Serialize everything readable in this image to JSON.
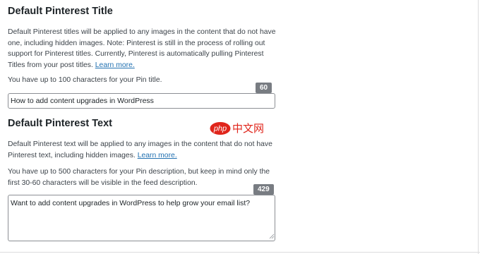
{
  "title_section": {
    "heading": "Default Pinterest Title",
    "description": "Default Pinterest titles will be applied to any images in the content that do not have one, including hidden images. Note: Pinterest is still in the process of rolling out support for Pinterest titles. Currently, Pinterest is automatically pulling Pinterest Titles from your post titles.",
    "learn_more": "Learn more.",
    "limit_note": "You have up to 100 characters for your Pin title.",
    "counter": "60",
    "value": "How to add content upgrades in WordPress"
  },
  "text_section": {
    "heading": "Default Pinterest Text",
    "description": "Default Pinterest text will be applied to any images in the content that do not have Pinterest text, including hidden images.",
    "learn_more": "Learn more.",
    "limit_note": "You have up to 500 characters for your Pin description, but keep in mind only the first 30-60 characters will be visible in the feed description.",
    "counter": "429",
    "value": "Want to add content upgrades in WordPress to help grow your email list?"
  },
  "watermark": {
    "brand": "php",
    "text": "中文网"
  },
  "colors": {
    "link": "#2271b1",
    "counter_bg": "#787c82",
    "watermark_red": "#e0251b"
  }
}
